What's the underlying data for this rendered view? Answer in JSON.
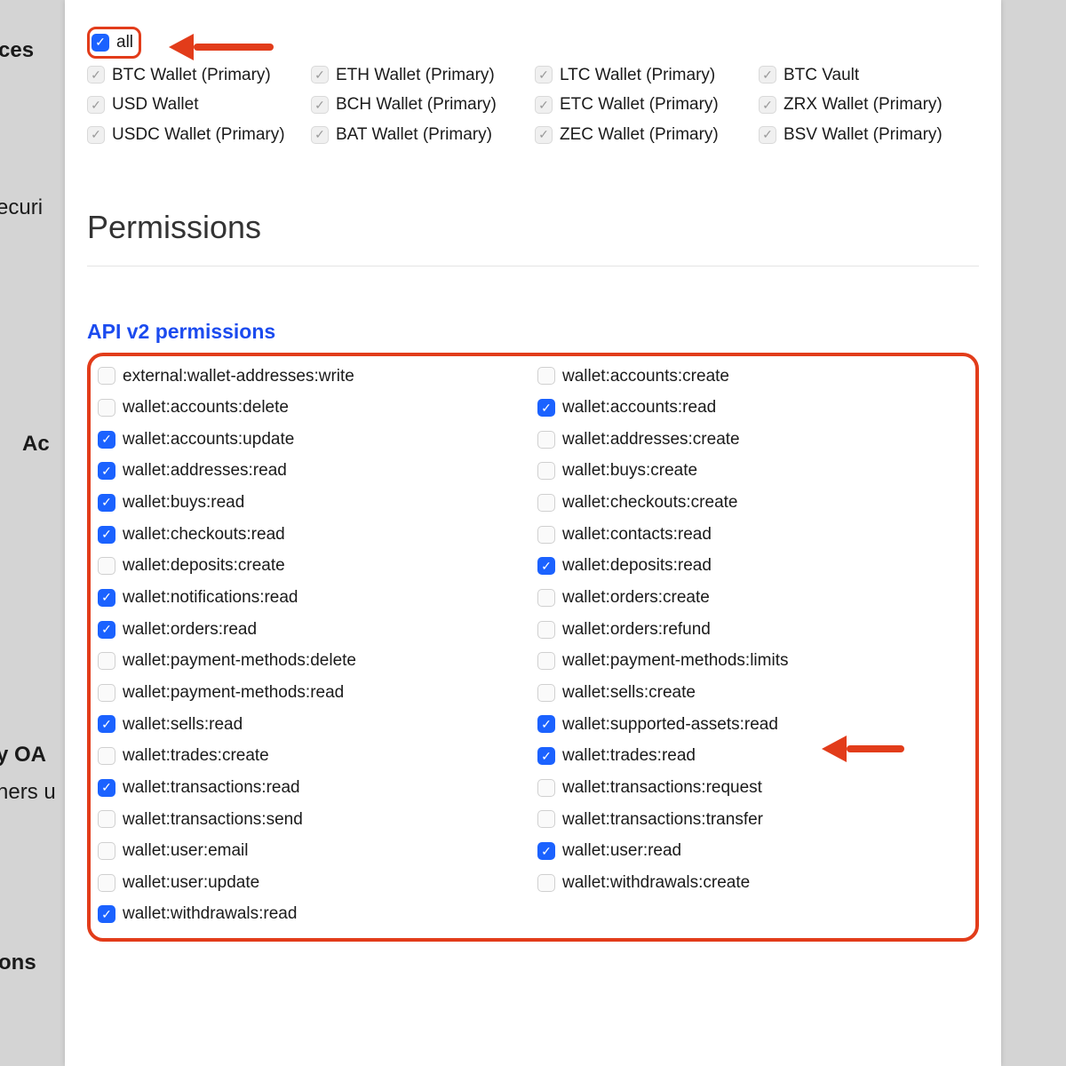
{
  "background": {
    "ces": "ces",
    "securi": "ecuri",
    "ac": "Ac",
    "oau": "y OA",
    "ners": "ners u",
    "ons": "ons"
  },
  "all_label": "all",
  "wallets": [
    {
      "label": "BTC Wallet (Primary)"
    },
    {
      "label": "ETH Wallet (Primary)"
    },
    {
      "label": "LTC Wallet (Primary)"
    },
    {
      "label": "BTC Vault"
    },
    {
      "label": "USD Wallet"
    },
    {
      "label": "BCH Wallet (Primary)"
    },
    {
      "label": "ETC Wallet (Primary)"
    },
    {
      "label": "ZRX Wallet (Primary)"
    },
    {
      "label": "USDC Wallet (Primary)"
    },
    {
      "label": "BAT Wallet (Primary)"
    },
    {
      "label": "ZEC Wallet (Primary)"
    },
    {
      "label": "BSV Wallet (Primary)"
    }
  ],
  "perm_heading": "Permissions",
  "api_heading": "API v2 permissions",
  "permissions": [
    {
      "label": "external:wallet-addresses:write",
      "checked": false
    },
    {
      "label": "wallet:accounts:create",
      "checked": false
    },
    {
      "label": "wallet:accounts:delete",
      "checked": false
    },
    {
      "label": "wallet:accounts:read",
      "checked": true
    },
    {
      "label": "wallet:accounts:update",
      "checked": true
    },
    {
      "label": "wallet:addresses:create",
      "checked": false
    },
    {
      "label": "wallet:addresses:read",
      "checked": true
    },
    {
      "label": "wallet:buys:create",
      "checked": false
    },
    {
      "label": "wallet:buys:read",
      "checked": true
    },
    {
      "label": "wallet:checkouts:create",
      "checked": false
    },
    {
      "label": "wallet:checkouts:read",
      "checked": true
    },
    {
      "label": "wallet:contacts:read",
      "checked": false
    },
    {
      "label": "wallet:deposits:create",
      "checked": false
    },
    {
      "label": "wallet:deposits:read",
      "checked": true
    },
    {
      "label": "wallet:notifications:read",
      "checked": true
    },
    {
      "label": "wallet:orders:create",
      "checked": false
    },
    {
      "label": "wallet:orders:read",
      "checked": true
    },
    {
      "label": "wallet:orders:refund",
      "checked": false
    },
    {
      "label": "wallet:payment-methods:delete",
      "checked": false
    },
    {
      "label": "wallet:payment-methods:limits",
      "checked": false
    },
    {
      "label": "wallet:payment-methods:read",
      "checked": false
    },
    {
      "label": "wallet:sells:create",
      "checked": false
    },
    {
      "label": "wallet:sells:read",
      "checked": true
    },
    {
      "label": "wallet:supported-assets:read",
      "checked": true
    },
    {
      "label": "wallet:trades:create",
      "checked": false
    },
    {
      "label": "wallet:trades:read",
      "checked": true
    },
    {
      "label": "wallet:transactions:read",
      "checked": true
    },
    {
      "label": "wallet:transactions:request",
      "checked": false
    },
    {
      "label": "wallet:transactions:send",
      "checked": false
    },
    {
      "label": "wallet:transactions:transfer",
      "checked": false
    },
    {
      "label": "wallet:user:email",
      "checked": false
    },
    {
      "label": "wallet:user:read",
      "checked": true
    },
    {
      "label": "wallet:user:update",
      "checked": false
    },
    {
      "label": "wallet:withdrawals:create",
      "checked": false
    },
    {
      "label": "wallet:withdrawals:read",
      "checked": true
    }
  ]
}
